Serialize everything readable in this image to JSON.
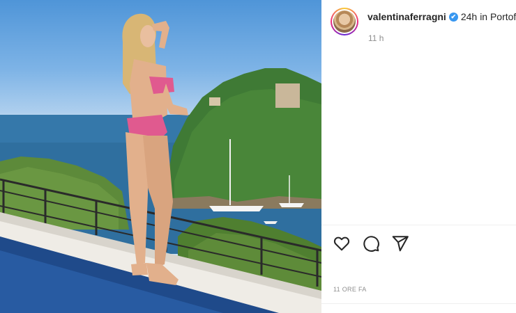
{
  "post": {
    "username": "valentinaferragni",
    "verified_badge": "✔",
    "age": "24h",
    "location": "in Portofino",
    "time_ago": "11 h",
    "timestamp_label": "11 ORE FA"
  },
  "photo": {
    "subject": "woman-in-pink-bikini-on-terrace",
    "scene": "portofino-coast-with-sailboats"
  },
  "actions": {
    "like_icon": "heart-icon",
    "comment_icon": "comment-icon",
    "share_icon": "share-icon"
  },
  "colors": {
    "sky": "#7db3e6",
    "sea": "#2f6f9f",
    "bikini": "#e05a8f",
    "verified": "#3897f0",
    "muted_text": "#8e8e8e"
  }
}
